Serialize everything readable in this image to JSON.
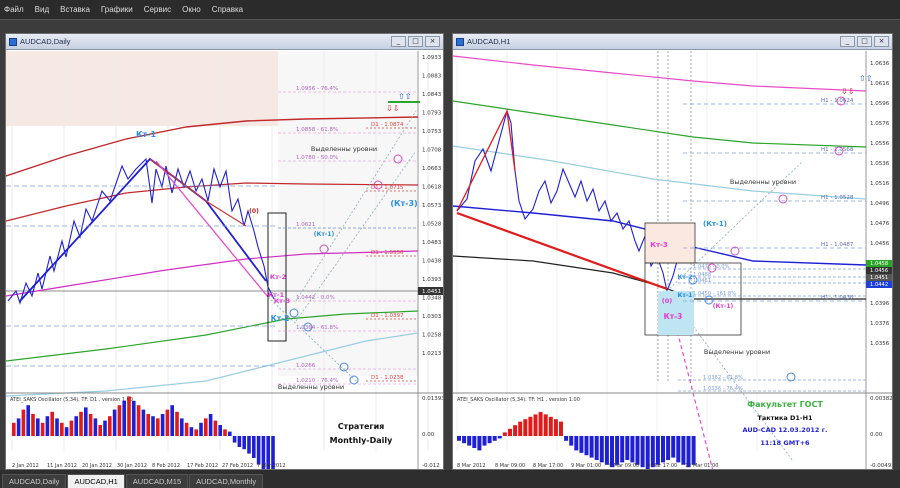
{
  "menu": [
    "Файл",
    "Вид",
    "Вставка",
    "Графики",
    "Сервис",
    "Окно",
    "Справка"
  ],
  "colors": {
    "bull": "#1f1fd6",
    "bear": "#e01b1b",
    "fibo": "#e06ad0",
    "level": "#6a8fd8",
    "panel": "#ffffff"
  },
  "left": {
    "title": "AUDCAD,Daily",
    "prices": [
      "1.0933",
      "1.0883",
      "1.0843",
      "1.0793",
      "1.0753",
      "1.0708",
      "1.0663",
      "1.0618",
      "1.0573",
      "1.0528",
      "1.0483",
      "1.0438",
      "1.0393",
      "1.0348",
      "1.0303",
      "1.0258",
      "1.0213"
    ],
    "current_price": "1.0451",
    "fibo": [
      "1.0956 - 76.4%",
      "1.0858 - 61.8%",
      "1.0780 - 50.0%",
      "1.0621",
      "1.0442 - 0.0%",
      "1.0364 - 61.8%",
      "1.0266",
      "1.0210 - 76.4%"
    ],
    "levels": [
      "D1 - 1.0874",
      "D1 - 1.0715",
      "D1 - 1.0556",
      "D1 - 1.0397",
      "D1 - 1.0238"
    ],
    "labels": {
      "kt1_top": "Кт-1",
      "kt1_mid": "(Кт-1)",
      "kt3": "(Кт-3)",
      "kt2": "Кт-2",
      "kt1": "Кт-1",
      "kt3b": "Кт-3",
      "kt2b": "Кт-2",
      "zero": "(0)",
      "sel1": "Выделенны уровни",
      "sel2": "Выделенны уровни"
    },
    "osc": {
      "label": "ATEI_SAKS Oscillator (5,34). TF: D1 , version 1.00",
      "top": "0.01393",
      "zero": "0.00",
      "bottom": "-0.012"
    },
    "strategy": [
      "Стратегия",
      "Monthly-Daily"
    ],
    "xaxis": [
      "2 Jan 2012",
      "11 Jan 2012",
      "20 Jan 2012",
      "30 Jan 2012",
      "8 Feb 2012",
      "17 Feb 2012",
      "27 Feb 2012",
      "7 Mar 2012"
    ]
  },
  "right": {
    "title": "AUDCAD,H1",
    "prices": [
      "1.0636",
      "1.0616",
      "1.0596",
      "1.0576",
      "1.0556",
      "1.0536",
      "1.0516",
      "1.0496",
      "1.0476",
      "1.0456",
      "1.0436",
      "1.0416",
      "1.0396",
      "1.0376",
      "1.0356"
    ],
    "price_boxes": [
      "1.0458",
      "1.0456",
      "1.0451",
      "1.0442"
    ],
    "fibo": [
      "1.0475 - 0.0%",
      "1.0468",
      "1.0461",
      "1.0450 - 161.8%",
      "1.0362 - 61.8%",
      "1.0336 - 76.4%"
    ],
    "levels": [
      "H1 - 1.0624",
      "H1 - 1.0568",
      "H1 - 1.0528",
      "H1 - 1.0487",
      "H1 - 1.0438"
    ],
    "labels": {
      "kt1": "(Кт-1)",
      "kt3": "Кт-3",
      "kt2": "Кт-2",
      "kt1b": "Кт-1",
      "kt1c": "(Кт-1)",
      "zero": "(0)",
      "kt3b": "Кт-3",
      "sel1": "Выделенны уровни",
      "sel2": "Выделенны уровни"
    },
    "osc": {
      "label": "ATEI_SAKS Oscillator (5,34). TF: H1 , version 1.00",
      "top": "0.00382",
      "zero": "0.00",
      "bottom": "-0.00492"
    },
    "caption": [
      "Факультет ГОСТ",
      "Тактика  D1-H1",
      "AUD-CAD 12.03.2012 г.",
      "11:18   GMT+6"
    ],
    "xaxis": [
      "8 Mar 2012",
      "8 Mar 09:00",
      "8 Mar 17:00",
      "9 Mar 01:00",
      "9 Mar 09:00",
      "9 Mar 17:00",
      "12 Mar 01:00"
    ]
  },
  "tabs": [
    "AUDCAD,Daily",
    "AUDCAD,H1",
    "AUDCAD,M15",
    "AUDCAD,Monthly"
  ],
  "active_tab": "AUDCAD,H1"
}
